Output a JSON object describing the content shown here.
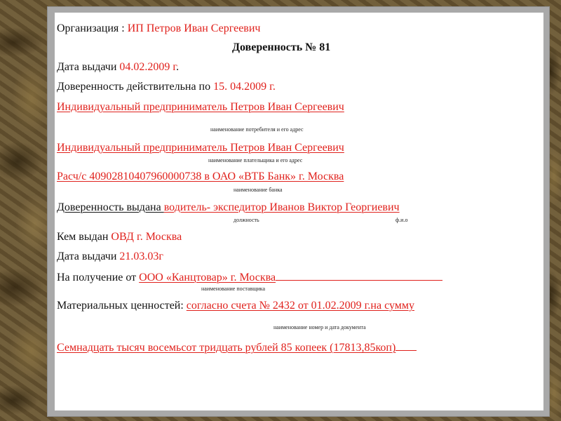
{
  "document": {
    "org_label": "Организация : ",
    "org_value": "ИП Петров Иван Сергеевич",
    "title": "Доверенность  № 81",
    "issue_date_label": "Дата выдачи ",
    "issue_date_value": "04.02.2009 г",
    "issue_date_dot": ".",
    "valid_label": "Доверенность действительна по ",
    "valid_value": "15. 04.2009 г.",
    "consumer_value": "Индивидуальный предприниматель Петров Иван  Сергеевич",
    "consumer_caption": "наименование потребителя и его адрес",
    "payer_value": "Индивидуальный предприниматель Петров Иван  Сергеевич",
    "payer_caption": "наименование плательщика и его адрес",
    "account_value": "Расч/с 40902810407960000738 в ОАО «ВТБ Банк» г. Москва",
    "bank_caption": "наименование банка",
    "issued_to_label": "Доверенность выдана ",
    "issued_to_value": "водитель- экспедитор   Иванов Виктор Георгиевич",
    "position_caption": "должность",
    "fio_caption": "ф.и.о",
    "issued_by_label": "Кем выдан ",
    "issued_by_value": "ОВД г. Москва",
    "passport_date_label": "Дата выдачи ",
    "passport_date_value": "21.03.03г",
    "receive_from_label": "На получение от  ",
    "receive_from_value": "ООО «Канцтовар» г. Москва",
    "supplier_caption": "наименование поставщика",
    "materials_label": "Материальных ценностей: ",
    "materials_value": "согласно счета № 2432 от 01.02.2009 г.на сумму",
    "doc_caption": "наименование номер и дата документа",
    "amount_value": "Семнадцать тысяч восемьсот тридцать рублей 85 копеек  (17813,85коп)"
  }
}
